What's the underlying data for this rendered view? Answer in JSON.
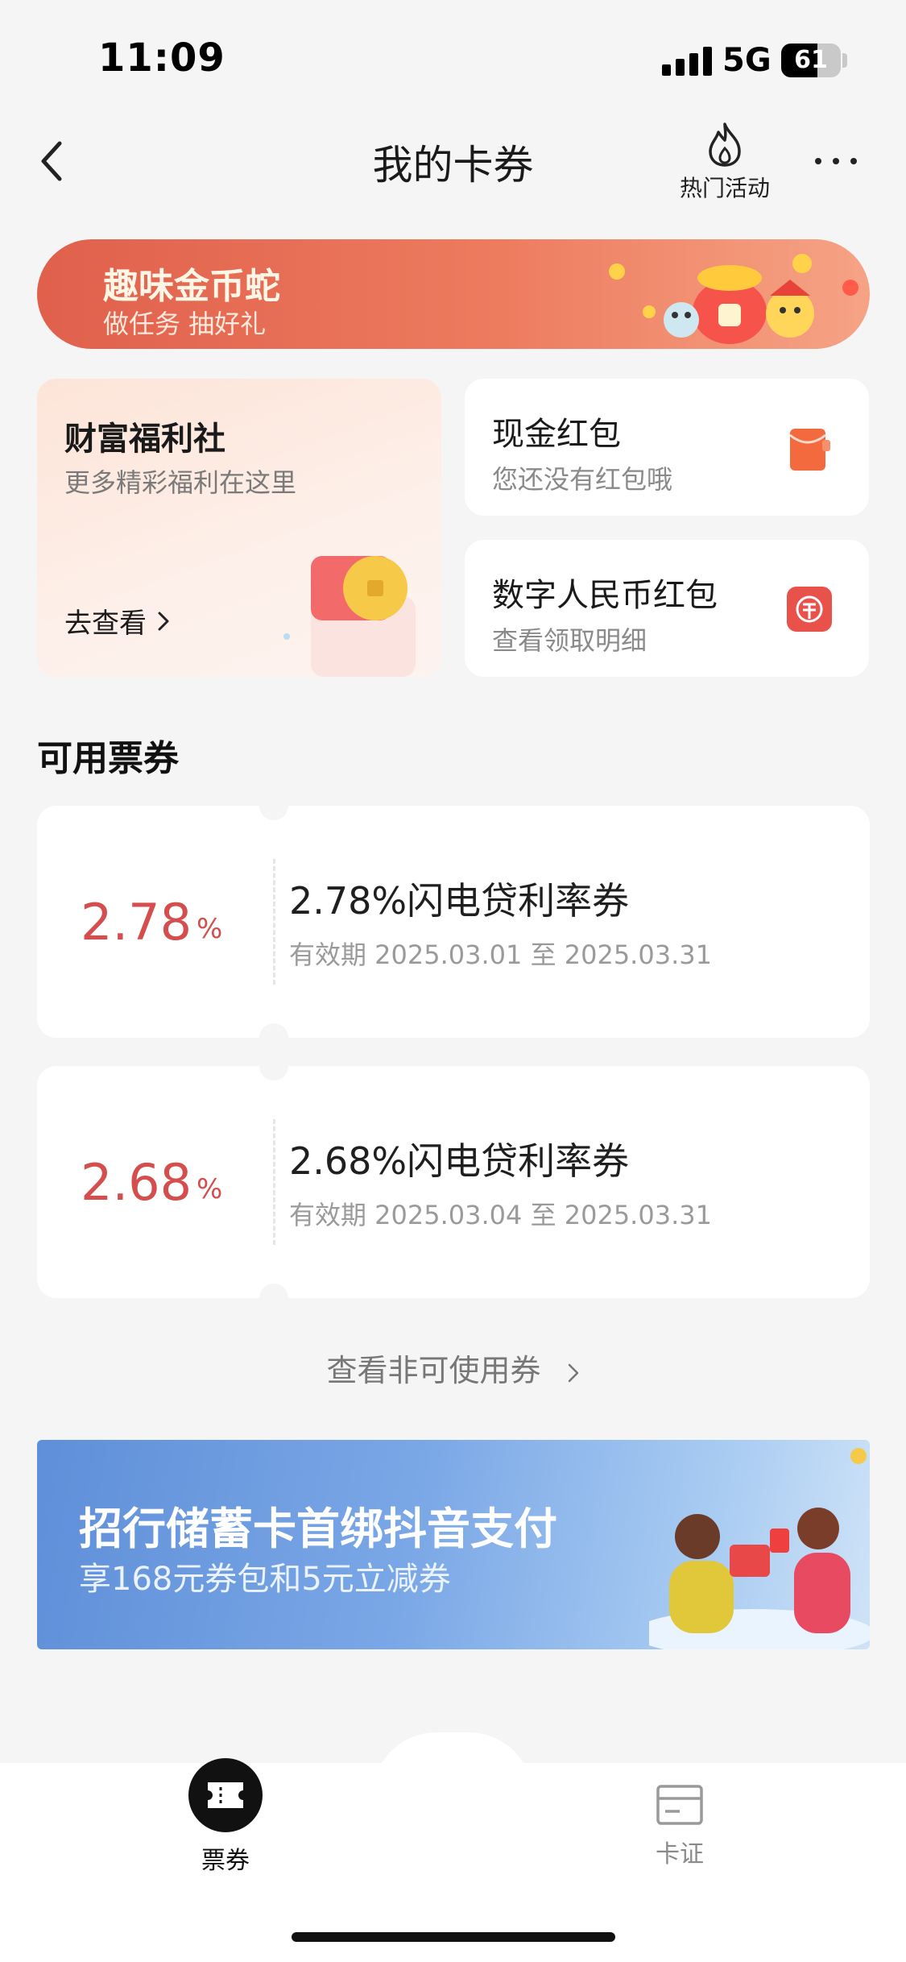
{
  "status_bar": {
    "time": "11:09",
    "network": "5G",
    "battery_level": "61"
  },
  "nav": {
    "title": "我的卡券",
    "hot_activity_label": "热门活动"
  },
  "top_banner": {
    "title": "趣味金币蛇",
    "subtitle": "做任务 抽好礼"
  },
  "welfare_card": {
    "title": "财富福利社",
    "subtitle": "更多精彩福利在这里",
    "action": "去查看"
  },
  "cash_card": {
    "title": "现金红包",
    "subtitle": "您还没有红包哦"
  },
  "digital_card": {
    "title": "数字人民币红包",
    "subtitle": "查看领取明细"
  },
  "section": {
    "available_title": "可用票券"
  },
  "coupons": [
    {
      "rate": "2.78",
      "unit": "%",
      "name": "2.78%闪电贷利率券",
      "validity": "有效期 2025.03.01 至 2025.03.31"
    },
    {
      "rate": "2.68",
      "unit": "%",
      "name": "2.68%闪电贷利率券",
      "validity": "有效期 2025.03.04 至 2025.03.31"
    }
  ],
  "view_unusable": "查看非可使用券",
  "promo_banner": {
    "title": "招行储蓄卡首绑抖音支付",
    "subtitle": "享168元券包和5元立减券"
  },
  "tabs": [
    {
      "label": "票券",
      "icon": "ticket-icon",
      "active": true
    },
    {
      "label": "卡证",
      "icon": "card-icon",
      "active": false
    }
  ],
  "colors": {
    "accent_red": "#d44e4e",
    "banner_orange": "#e0604c",
    "promo_blue": "#5f8fd9"
  }
}
